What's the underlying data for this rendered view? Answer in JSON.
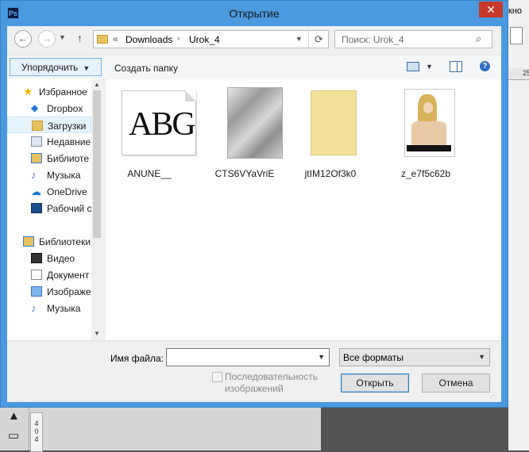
{
  "background": {
    "right_text": "кно",
    "ruler_num": "25",
    "vruler_nums": [
      "4",
      "0",
      "4"
    ],
    "tools": [
      "▲",
      "▭"
    ]
  },
  "dialog": {
    "title": "Открытие",
    "app_icon": "Ps",
    "close": "✕"
  },
  "address": {
    "back": "←",
    "forward": "→",
    "up": "↑",
    "chev": "«",
    "path": [
      "Downloads",
      "Urok_4"
    ],
    "sep": "›",
    "refresh": "⟳"
  },
  "search": {
    "placeholder": "Поиск: Urok_4",
    "icon": "search-icon"
  },
  "toolbar": {
    "organize": "Упорядочить",
    "new_folder": "Создать папку",
    "help": "?"
  },
  "nav": {
    "items": [
      {
        "label": "Избранное",
        "icon": "star-icon",
        "head": true
      },
      {
        "label": "Dropbox",
        "icon": "dropbox-icon"
      },
      {
        "label": "Загрузки",
        "icon": "downloads-folder-icon",
        "selected": true
      },
      {
        "label": "Недавние",
        "icon": "recent-places-icon"
      },
      {
        "label": "Библиоте",
        "icon": "library-icon"
      },
      {
        "label": "Музыка",
        "icon": "music-icon"
      },
      {
        "label": "OneDrive",
        "icon": "onedrive-icon"
      },
      {
        "label": "Рабочий с",
        "icon": "desktop-icon"
      },
      {
        "label": "Библиотеки",
        "icon": "libraries-icon",
        "head": true
      },
      {
        "label": "Видео",
        "icon": "video-icon"
      },
      {
        "label": "Документ",
        "icon": "document-icon"
      },
      {
        "label": "Изображе",
        "icon": "image-icon"
      },
      {
        "label": "Музыка",
        "icon": "music-icon"
      }
    ]
  },
  "files": [
    {
      "name": "ANUNE__",
      "thumb_text": "ABG",
      "kind": "font"
    },
    {
      "name": "CTS6VYaVriE",
      "kind": "texture"
    },
    {
      "name": "jtIM12Of3k0",
      "kind": "yellow-paper"
    },
    {
      "name": "z_e7f5c62b",
      "kind": "photo"
    }
  ],
  "bottom": {
    "filename_label": "Имя файла:",
    "filename_value": "",
    "format": "Все форматы",
    "sequence_label": "Последовательность изображений",
    "open": "Открыть",
    "cancel": "Отмена"
  }
}
